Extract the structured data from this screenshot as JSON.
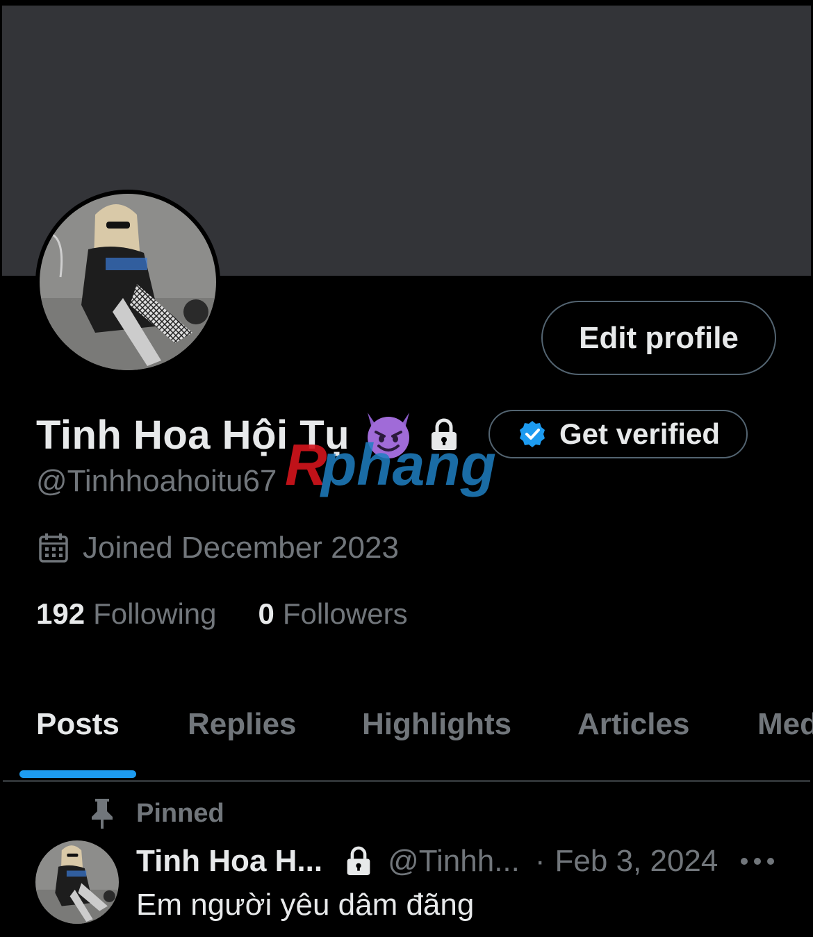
{
  "profile": {
    "display_name": "Tinh Hoa Hội Tụ",
    "name_emoji": "smiling-devil-emoji",
    "handle": "@Tinhhoahoitu67",
    "joined": "Joined December 2023",
    "edit_button": "Edit profile",
    "verify_button": "Get verified",
    "following_count": "192",
    "following_label": "Following",
    "followers_count": "0",
    "followers_label": "Followers"
  },
  "tabs": [
    {
      "label": "Posts",
      "active": true
    },
    {
      "label": "Replies",
      "active": false
    },
    {
      "label": "Highlights",
      "active": false
    },
    {
      "label": "Articles",
      "active": false
    },
    {
      "label": "Media",
      "active": false
    }
  ],
  "pinned_post": {
    "pinned_label": "Pinned",
    "author_name": "Tinh Hoa H...",
    "author_handle": "@Tinhh...",
    "separator": "·",
    "date": "Feb 3, 2024",
    "text": "Em người yêu dâm đãng"
  },
  "watermark": {
    "text": "Rphang"
  },
  "colors": {
    "background": "#000000",
    "banner": "#333438",
    "accent": "#1d9bf0",
    "muted_text": "#71767b",
    "border": "#536471"
  }
}
